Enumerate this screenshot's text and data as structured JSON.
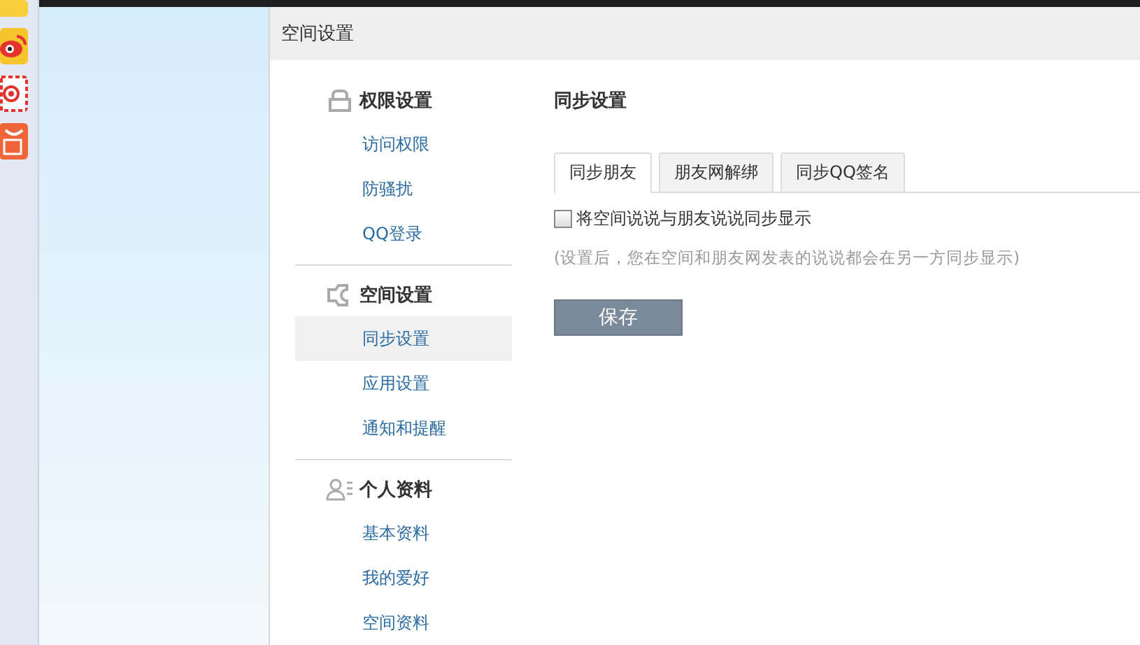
{
  "panel": {
    "title": "空间设置"
  },
  "sidebar": {
    "sections": [
      {
        "title": "权限设置",
        "kind": "access",
        "items": [
          {
            "label": "访问权限",
            "selected": false
          },
          {
            "label": "防骚扰",
            "selected": false
          },
          {
            "label": "QQ登录",
            "selected": false
          }
        ]
      },
      {
        "title": "空间设置",
        "kind": "space",
        "items": [
          {
            "label": "同步设置",
            "selected": true
          },
          {
            "label": "应用设置",
            "selected": false
          },
          {
            "label": "通知和提醒",
            "selected": false
          }
        ]
      },
      {
        "title": "个人资料",
        "kind": "profile",
        "items": [
          {
            "label": "基本资料",
            "selected": false
          },
          {
            "label": "我的爱好",
            "selected": false
          },
          {
            "label": "空间资料",
            "selected": false
          }
        ]
      }
    ]
  },
  "content": {
    "title": "同步设置",
    "tabs": [
      {
        "label": "同步朋友",
        "selected": true
      },
      {
        "label": "朋友网解绑",
        "selected": false
      },
      {
        "label": "同步QQ签名",
        "selected": false
      }
    ],
    "option": {
      "label": "将空间说说与朋友说说同步显示",
      "checked": false
    },
    "hint": "(设置后，您在空间和朋友网发表的说说都会在另一方同步显示)",
    "save_button": "保存"
  }
}
